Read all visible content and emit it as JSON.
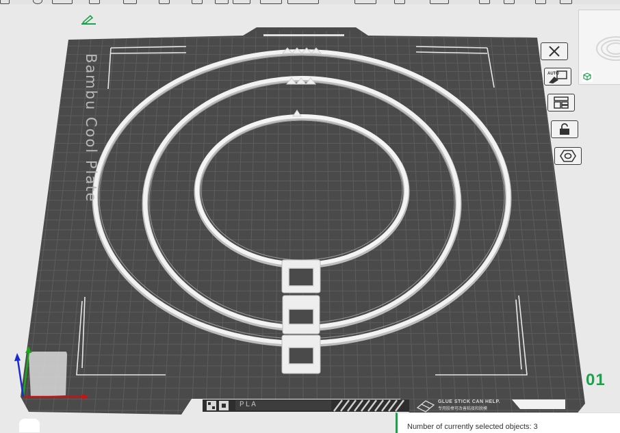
{
  "plate": {
    "label": "Bambu Cool Plate",
    "number": "01",
    "filament": "PLA",
    "glue_notice_en": "GLUE STICK CAN HELP.",
    "glue_notice_cn": "专用胶棒可改善粘接和脱模"
  },
  "notification": {
    "text": "Number of currently selected objects: 3"
  },
  "toolbar_right": [
    {
      "name": "close-plate-button",
      "icon": "close-icon"
    },
    {
      "name": "auto-arrange-button",
      "icon": "auto-orient-icon"
    },
    {
      "name": "arrange-button",
      "icon": "arrange-icon"
    },
    {
      "name": "lock-plate-button",
      "icon": "unlock-icon"
    },
    {
      "name": "plate-settings-button",
      "icon": "hexagon-nut-icon"
    }
  ],
  "colors": {
    "plate": "#4a4a4a",
    "grid": "#5c5c5c",
    "model": "#eeeeee",
    "accent_green": "#1aa34a",
    "axis_x": "#d01010",
    "axis_y": "#18a818",
    "axis_z": "#1a2ad0"
  },
  "objects_selected": 3
}
